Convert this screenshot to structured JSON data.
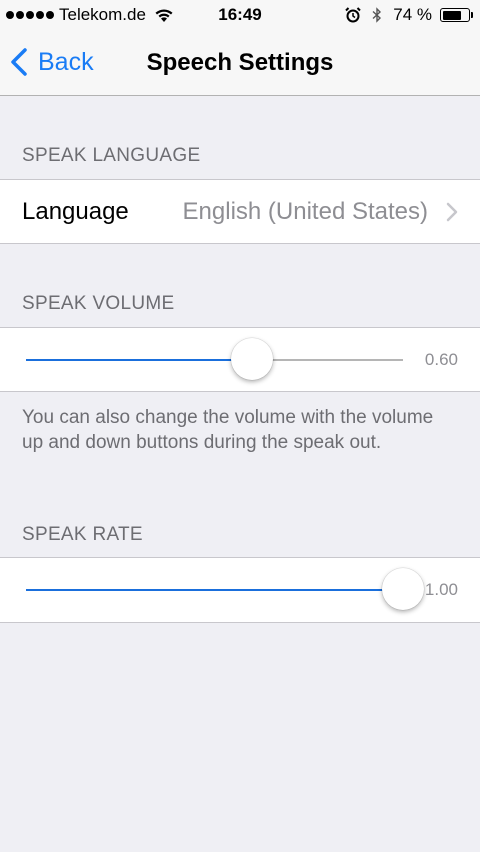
{
  "status_bar": {
    "carrier": "Telekom.de",
    "time": "16:49",
    "battery_percent_label": "74 %",
    "battery_level": 0.74
  },
  "nav": {
    "back_label": "Back",
    "title": "Speech Settings"
  },
  "language_section": {
    "header": "SPEAK LANGUAGE",
    "label": "Language",
    "value": "English (United States)"
  },
  "volume_section": {
    "header": "SPEAK VOLUME",
    "value": 0.6,
    "value_label": "0.60",
    "footer": "You can also change the volume with the volume up and down buttons during the speak out."
  },
  "rate_section": {
    "header": "SPEAK RATE",
    "value": 1.0,
    "value_label": "1.00"
  },
  "colors": {
    "accent": "#1a7cf5",
    "slider_fill": "#1a6fdc",
    "background": "#efeff4"
  },
  "icons": [
    "signal-dots-icon",
    "wifi-icon",
    "alarm-icon",
    "bluetooth-icon",
    "battery-icon",
    "back-chevron-icon",
    "chevron-right-icon"
  ]
}
